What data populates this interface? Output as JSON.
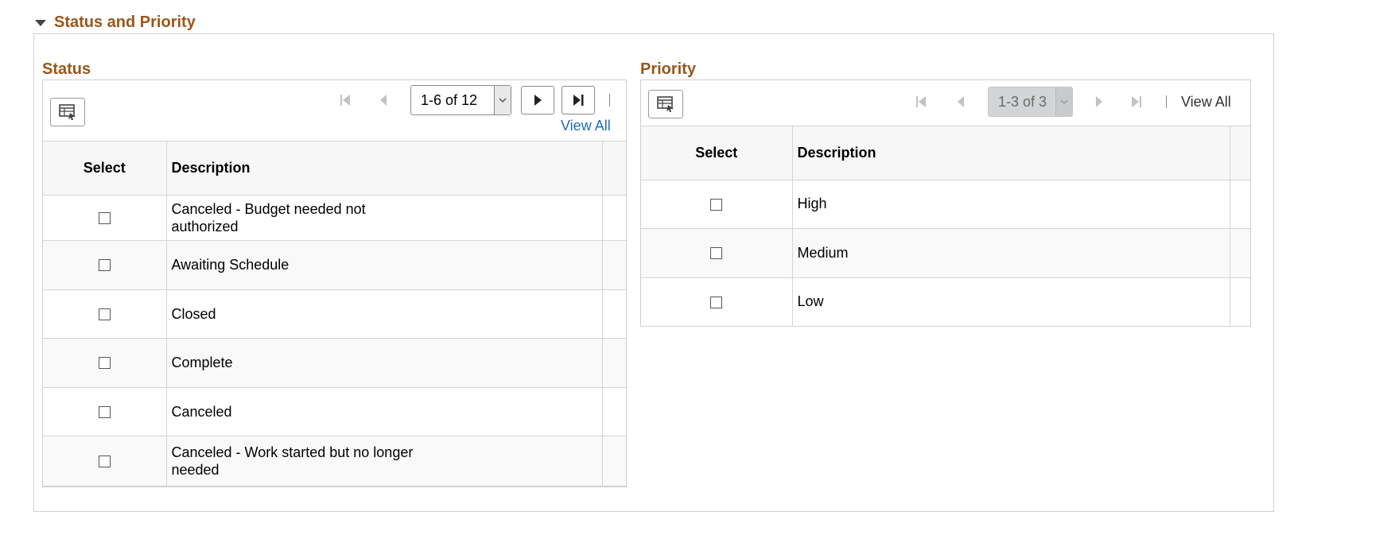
{
  "section": {
    "title": "Status and Priority"
  },
  "status_grid": {
    "title": "Status",
    "pager": {
      "range": "1-6 of 12",
      "view_all": "View All"
    },
    "columns": {
      "select": "Select",
      "description": "Description"
    },
    "rows": [
      {
        "description": "Canceled - Budget needed not authorized"
      },
      {
        "description": "Awaiting Schedule"
      },
      {
        "description": "Closed"
      },
      {
        "description": "Complete"
      },
      {
        "description": "Canceled"
      },
      {
        "description": "Canceled - Work started but no longer needed"
      }
    ]
  },
  "priority_grid": {
    "title": "Priority",
    "pager": {
      "range": "1-3 of 3",
      "view_all": "View All"
    },
    "columns": {
      "select": "Select",
      "description": "Description"
    },
    "rows": [
      {
        "description": "High"
      },
      {
        "description": "Medium"
      },
      {
        "description": "Low"
      }
    ]
  },
  "icons": {
    "collapse": "triangle-down-icon",
    "personalize": "grid-personalize-icon",
    "first": "first-page-icon",
    "previous": "previous-page-icon",
    "next": "next-page-icon",
    "last": "last-page-icon",
    "dropdown": "chevron-down-icon"
  },
  "colors": {
    "section_title": "#9b561b",
    "link": "#1f6cbf"
  }
}
